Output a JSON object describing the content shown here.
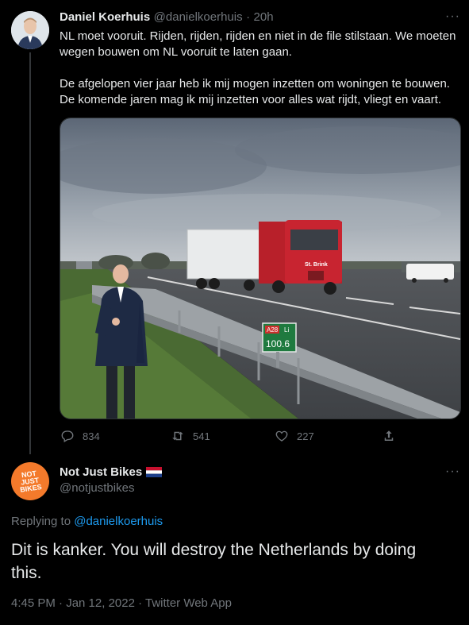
{
  "tweet1": {
    "author_name": "Daniel Koerhuis",
    "handle": "@danielkoerhuis",
    "separator": "·",
    "time": "20h",
    "more": "···",
    "line1": "NL moet vooruit. Rijden, rijden, rijden en niet in de file stilstaan. We moeten",
    "line2": "wegen bouwen om NL vooruit te laten gaan.",
    "line3": "De afgelopen vier jaar heb ik mij mogen inzetten om woningen te bouwen.",
    "line4": "De komende jaren mag ik mij inzetten voor alles wat rijdt, vliegt en vaart.",
    "photo": {
      "truck_brand": "St. Brink",
      "sign_road": "A28",
      "sign_side": "Li",
      "sign_km": "100.6"
    },
    "actions": {
      "replies": "834",
      "retweets": "541",
      "likes": "227"
    }
  },
  "tweet2": {
    "author_name": "Not Just Bikes",
    "handle": "@notjustbikes",
    "more": "···",
    "avatar_text": [
      "NOT",
      "JUST",
      "BIKES"
    ],
    "replying_prefix": "Replying to ",
    "replying_to": "@danielkoerhuis",
    "text_line1": "Dit is kanker. You will destroy the Netherlands by doing",
    "text_line2": "this.",
    "timestamp": "4:45 PM · Jan 12, 2022 · Twitter Web App"
  },
  "colors": {
    "background": "#000000",
    "text": "#e7e9ea",
    "muted": "#71767b",
    "link": "#1d9bf0",
    "avatar_orange": "#f47a2b"
  }
}
